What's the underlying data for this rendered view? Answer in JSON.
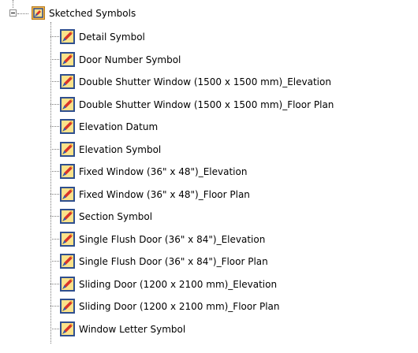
{
  "tree": {
    "root": {
      "label": "Sketched Symbols",
      "expanded": true,
      "icon": "sketched-symbols-folder-icon"
    },
    "children": [
      {
        "label": "Detail Symbol",
        "icon": "sketched-symbol-icon"
      },
      {
        "label": "Door Number Symbol",
        "icon": "sketched-symbol-icon"
      },
      {
        "label": "Double Shutter Window (1500 x 1500 mm)_Elevation",
        "icon": "sketched-symbol-icon"
      },
      {
        "label": "Double Shutter Window (1500 x 1500 mm)_Floor Plan",
        "icon": "sketched-symbol-icon"
      },
      {
        "label": "Elevation Datum",
        "icon": "sketched-symbol-icon"
      },
      {
        "label": "Elevation Symbol",
        "icon": "sketched-symbol-icon"
      },
      {
        "label": "Fixed Window (36\" x 48\")_Elevation",
        "icon": "sketched-symbol-icon"
      },
      {
        "label": "Fixed Window (36\" x 48\")_Floor Plan",
        "icon": "sketched-symbol-icon"
      },
      {
        "label": "Section Symbol",
        "icon": "sketched-symbol-icon"
      },
      {
        "label": "Single Flush Door (36\" x 84\")_Elevation",
        "icon": "sketched-symbol-icon"
      },
      {
        "label": "Single Flush Door (36\" x 84\")_Floor Plan",
        "icon": "sketched-symbol-icon"
      },
      {
        "label": "Sliding Door (1200 x 2100 mm)_Elevation",
        "icon": "sketched-symbol-icon"
      },
      {
        "label": "Sliding Door (1200 x 2100 mm)_Floor Plan",
        "icon": "sketched-symbol-icon"
      },
      {
        "label": "Window Letter Symbol",
        "icon": "sketched-symbol-icon"
      }
    ]
  },
  "colors": {
    "icon_frame": "#2f4f8f",
    "icon_fill": "#fbe28a",
    "pencil_red": "#d8342a",
    "pencil_orange": "#f19a2c",
    "pencil_blue": "#2e5fb6",
    "guide_line": "#7a7a7a"
  }
}
